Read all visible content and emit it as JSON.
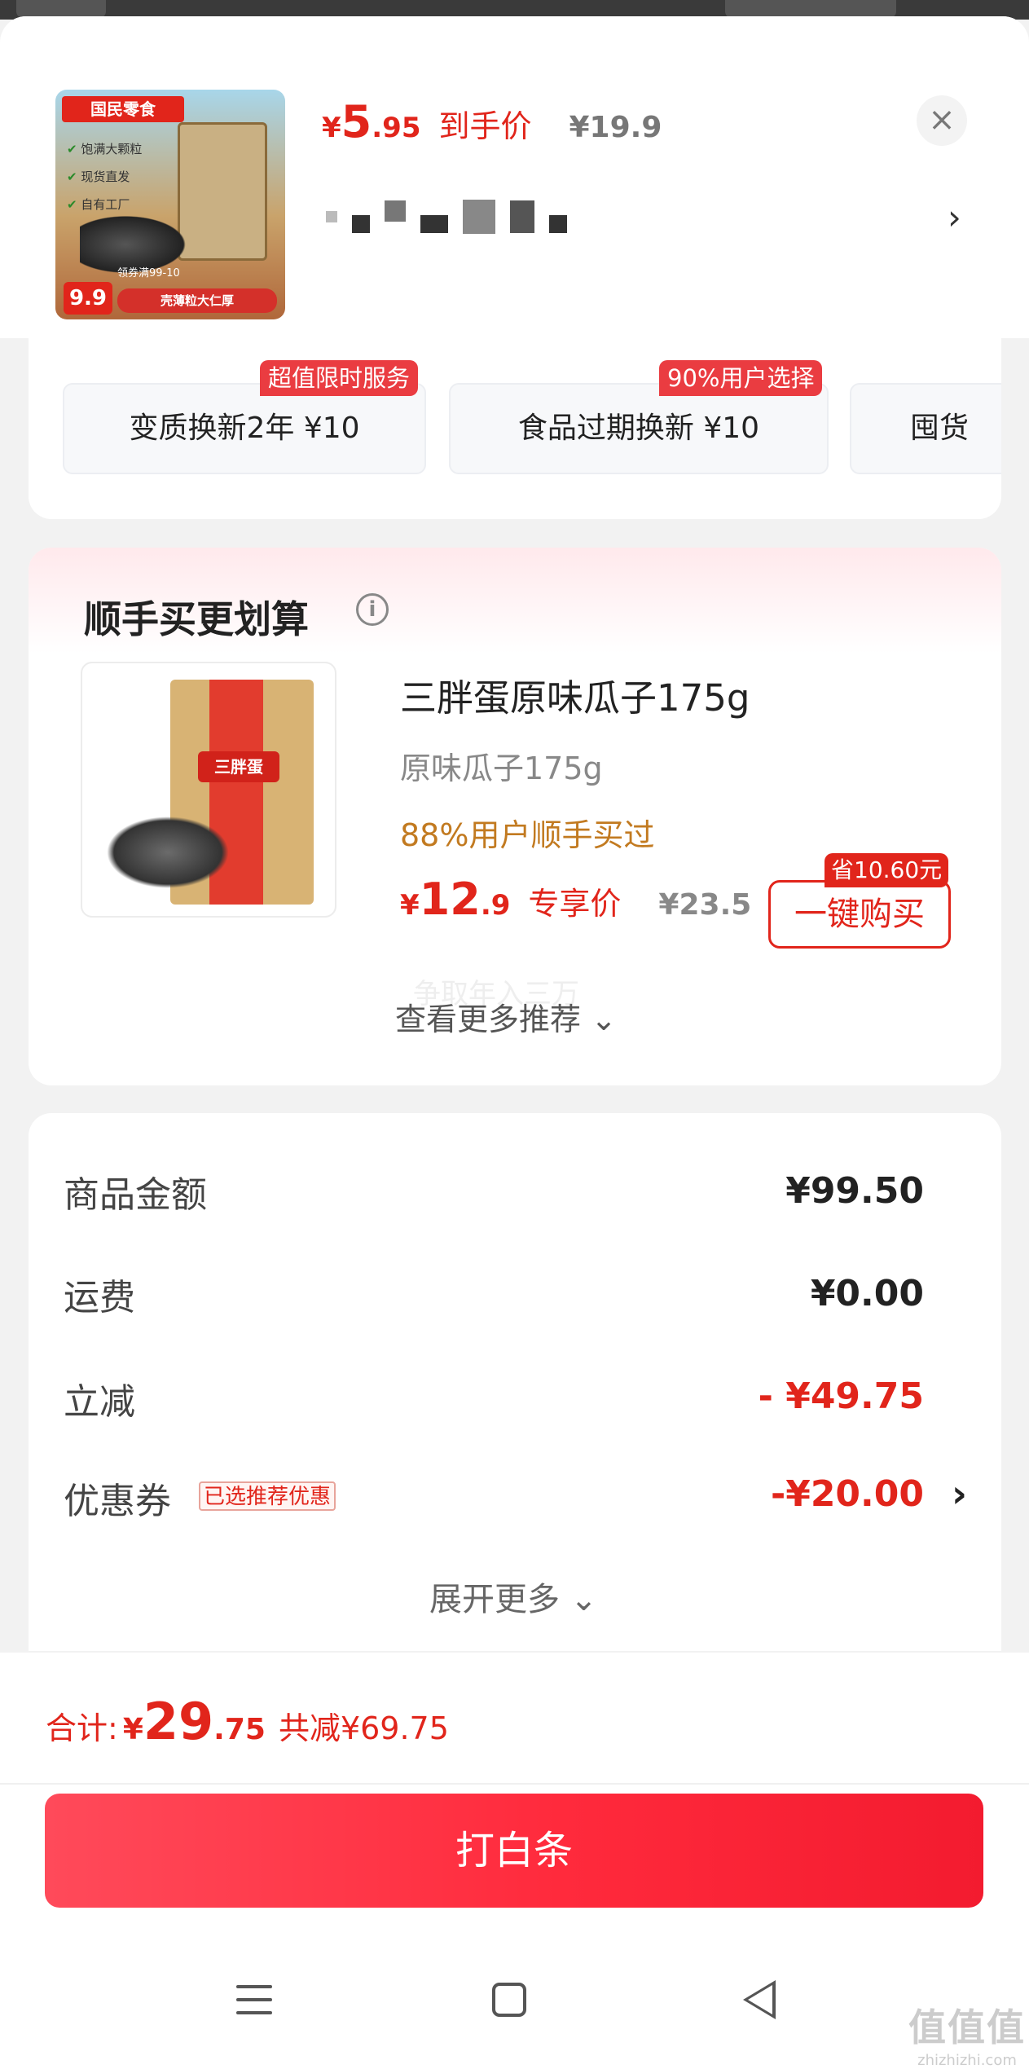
{
  "product": {
    "brand_label": "国民零食",
    "thumb_bullets": [
      "饱满大颗粒",
      "现货直发",
      "自有工厂"
    ],
    "thumb_price": "9.9",
    "thumb_strip": "领券满99-10",
    "thumb_ribbon": "壳薄粒大仁厚",
    "price_yen": "¥",
    "price_int": "5",
    "price_dec": ".95",
    "price_label": "到手价",
    "original_price": "¥19.9"
  },
  "services": [
    {
      "text": "变质换新2年  ¥10",
      "badge": "超值限时服务"
    },
    {
      "text": "食品过期换新  ¥10",
      "badge": "90%用户选择"
    },
    {
      "text": "囤货",
      "badge": ""
    }
  ],
  "bundle": {
    "title": "顺手买更划算",
    "product_name": "三胖蛋原味瓜子175g",
    "product_spec": "原味瓜子175g",
    "users_bought": "88%用户顺手买过",
    "price_yen": "¥",
    "price_int": "12",
    "price_dec": ".9",
    "price_label": "专享价",
    "original_price": "¥23.5",
    "buy_label": "一键购买",
    "save_badge": "省10.60元",
    "bag_logo": "三胖蛋",
    "ghost_text": "争取年入三万",
    "more_label": "查看更多推荐 ⌄"
  },
  "summary": {
    "rows": [
      {
        "label": "商品金额",
        "value": "¥99.50"
      },
      {
        "label": "运费",
        "value": "¥0.00"
      },
      {
        "label": "立减",
        "value": "- ¥49.75"
      },
      {
        "label": "优惠券",
        "value": "-¥20.00"
      }
    ],
    "coupon_tag": "已选推荐优惠",
    "expand_label": "展开更多 ⌄"
  },
  "footer": {
    "total_label": "合计:",
    "total_yen": "¥",
    "total_int": "29",
    "total_dec": ".75",
    "total_reduce": "共减¥69.75",
    "pay_label": "打白条"
  },
  "watermark": {
    "line1": "值值值",
    "line2": "zhizhizhi.com"
  },
  "colors": {
    "accent": "#e1251b",
    "pay_button": "#ff2a3c",
    "users_text": "#c27a20"
  }
}
